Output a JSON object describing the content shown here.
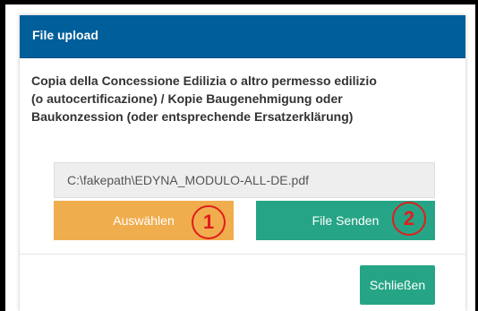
{
  "modal": {
    "title": "File upload",
    "description_lines": [
      "Copia della Concessione Edilizia o altro permesso edilizio",
      "(o autocertificazione) / Kopie Baugenehmigung oder",
      "Baukonzession (oder entsprechende Ersatzerklärung)"
    ],
    "file_path": "C:\\fakepath\\EDYNA_MODULO-ALL-DE.pdf",
    "buttons": {
      "choose_label": "Auswählen",
      "send_label": "File Senden",
      "close_label": "Schließen"
    },
    "annotations": [
      "1",
      "2"
    ]
  },
  "colors": {
    "header_bg": "#005e9a",
    "choose_button": "#f0ad4e",
    "send_button": "#26a586",
    "close_button": "#26a586",
    "annotation_red": "#e11d1d"
  }
}
